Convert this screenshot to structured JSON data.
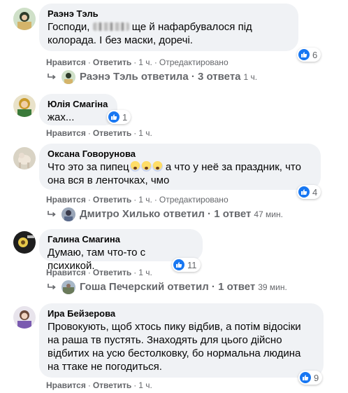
{
  "labels": {
    "like": "Нравится",
    "reply": "Ответить",
    "separator": "·",
    "edited": "Отредактировано"
  },
  "colors": {
    "bubble": "#f0f2f5",
    "like_blue": "#1877f2",
    "meta_gray": "#65676b",
    "text": "#050505"
  },
  "comments": [
    {
      "author": "Раэнэ Тэль",
      "text_before_blur": "Господи, ",
      "text_after_blur": " ще й нафарбувалося під колорада. І без маски, доречі.",
      "like_count": "6",
      "time": "1 ч.",
      "edited": true,
      "replies": {
        "text": "Раэнэ Тэль ответила · 3 ответа",
        "time": "1 ч."
      }
    },
    {
      "author": "Юлія Смагіна",
      "text": "жах...",
      "like_count": "1",
      "time": "1 ч."
    },
    {
      "author": "Оксана Говорунова",
      "text_before_emoji": "Что это за пипец",
      "text_after_emoji": " а что у неё за праздник, что она вся в ленточках, чмо",
      "like_count": "4",
      "time": "1 ч.",
      "edited": true,
      "replies": {
        "text": "Дмитро Хилько ответил · 1 ответ",
        "time": "47 мин."
      }
    },
    {
      "author": "Галина Смагина",
      "text": "Думаю, там что-то с психикой.",
      "like_count": "11",
      "time": "1 ч.",
      "replies": {
        "text": "Гоша Печерский ответил · 1 ответ",
        "time": "39 мин."
      }
    },
    {
      "author": "Ира Бейзерова",
      "text": "Провокують, щоб хтось пику відбив, а потім відосіки на раша тв пустять. Знаходять для цього дійсно відбитих на усю бестолковку, бо нормальна людина на ттаке не погодиться.",
      "like_count": "9",
      "time": "1 ч."
    }
  ]
}
